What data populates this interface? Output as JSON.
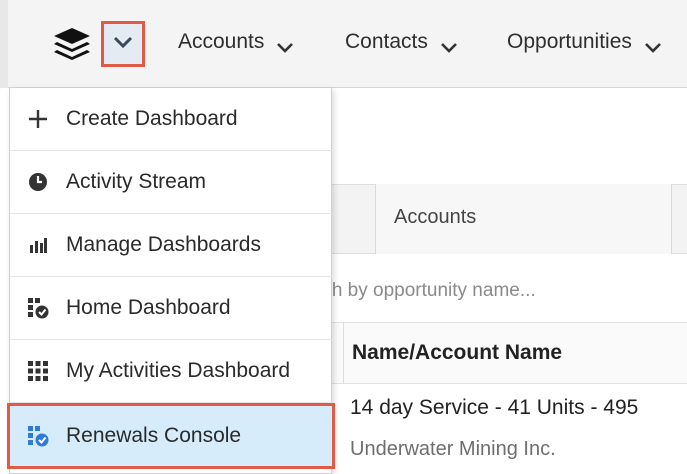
{
  "nav": {
    "logo_icon": "stacked-layers-icon",
    "home_caret_icon": "chevron-down-icon",
    "items": [
      {
        "label": "Accounts"
      },
      {
        "label": "Contacts"
      },
      {
        "label": "Opportunities"
      }
    ]
  },
  "background": {
    "tab_label": "Accounts",
    "search_placeholder": "rch by opportunity name...",
    "column_header": "Name/Account Name",
    "row_title": "14 day Service - 41 Units - 495",
    "row_subtitle": "Underwater Mining Inc."
  },
  "menu": {
    "items": [
      {
        "label": "Create Dashboard",
        "icon": "plus-icon"
      },
      {
        "label": "Activity Stream",
        "icon": "clock-icon"
      },
      {
        "label": "Manage Dashboards",
        "icon": "bar-chart-icon"
      },
      {
        "label": "Home Dashboard",
        "icon": "dashboard-check-icon"
      },
      {
        "label": "My Activities Dashboard",
        "icon": "grid-icon"
      },
      {
        "label": "Renewals Console",
        "icon": "dashboard-check-icon",
        "selected": true
      }
    ]
  },
  "colors": {
    "highlight_border": "#e05a45",
    "selected_bg": "#d6ecfb",
    "icon_blue": "#2f7bd9"
  }
}
